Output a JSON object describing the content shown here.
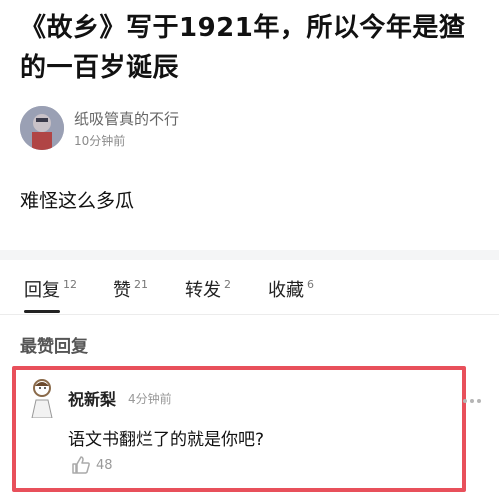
{
  "post": {
    "title": "《故乡》写于1921年，所以今年是猹的一百岁诞辰",
    "author_name": "纸吸管真的不行",
    "time": "10分钟前",
    "body": "难怪这么多瓜"
  },
  "tabs": [
    {
      "label": "回复",
      "count": "12"
    },
    {
      "label": "赞",
      "count": "21"
    },
    {
      "label": "转发",
      "count": "2"
    },
    {
      "label": "收藏",
      "count": "6"
    }
  ],
  "best_replies": {
    "heading": "最赞回复",
    "comment": {
      "user": "祝新梨",
      "time": "4分钟前",
      "text": "语文书翻烂了的就是你吧?",
      "likes": "48"
    }
  },
  "colors": {
    "highlight": "#e8505b",
    "text": "#111111",
    "muted": "#999999"
  },
  "icons": [
    "avatar",
    "thumbs-up-icon",
    "more-icon"
  ]
}
